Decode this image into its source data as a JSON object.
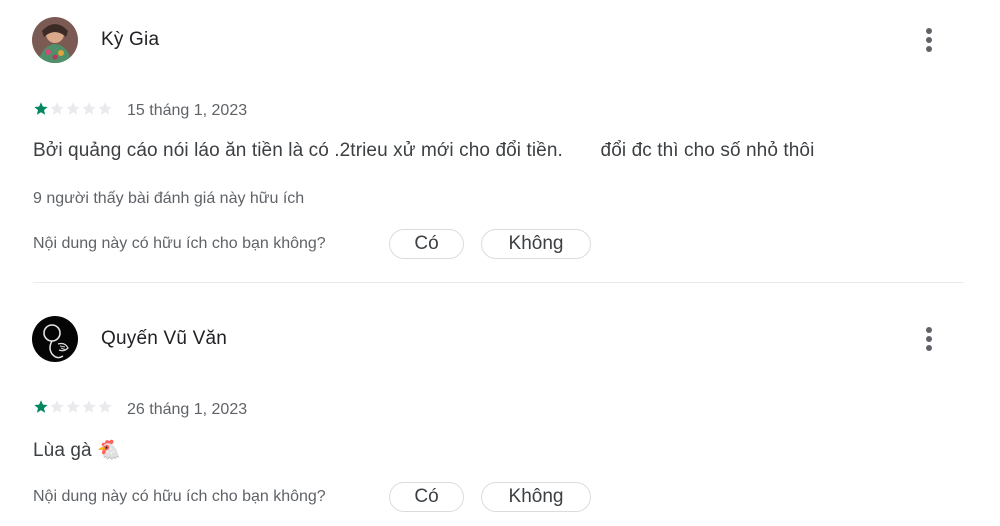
{
  "reviews": [
    {
      "author": "Kỳ Gia",
      "rating": 1,
      "max_rating": 5,
      "date": "15 tháng 1, 2023",
      "text": "Bởi quảng cáo nói láo ăn tiền là có .2trieu xử mới cho đổi tiền.       đổi đc thì cho số nhỏ thôi",
      "helpful_count_text": "9 người thấy bài đánh giá này hữu ích",
      "question": "Nội dung này có hữu ích cho bạn không?",
      "yes_label": "Có",
      "no_label": "Không"
    },
    {
      "author": "Quyến Vũ Văn",
      "rating": 1,
      "max_rating": 5,
      "date": "26 tháng 1, 2023",
      "text": "Lùa gà 🐔",
      "question": "Nội dung này có hữu ích cho bạn không?",
      "yes_label": "Có",
      "no_label": "Không"
    }
  ],
  "colors": {
    "star_filled": "#01875f",
    "star_empty": "#e8eaed",
    "text_primary": "#202124",
    "text_secondary": "#5f6368",
    "divider": "#e8eaed"
  },
  "icons": {
    "more_menu": "more-vert-icon",
    "star": "star-icon"
  }
}
